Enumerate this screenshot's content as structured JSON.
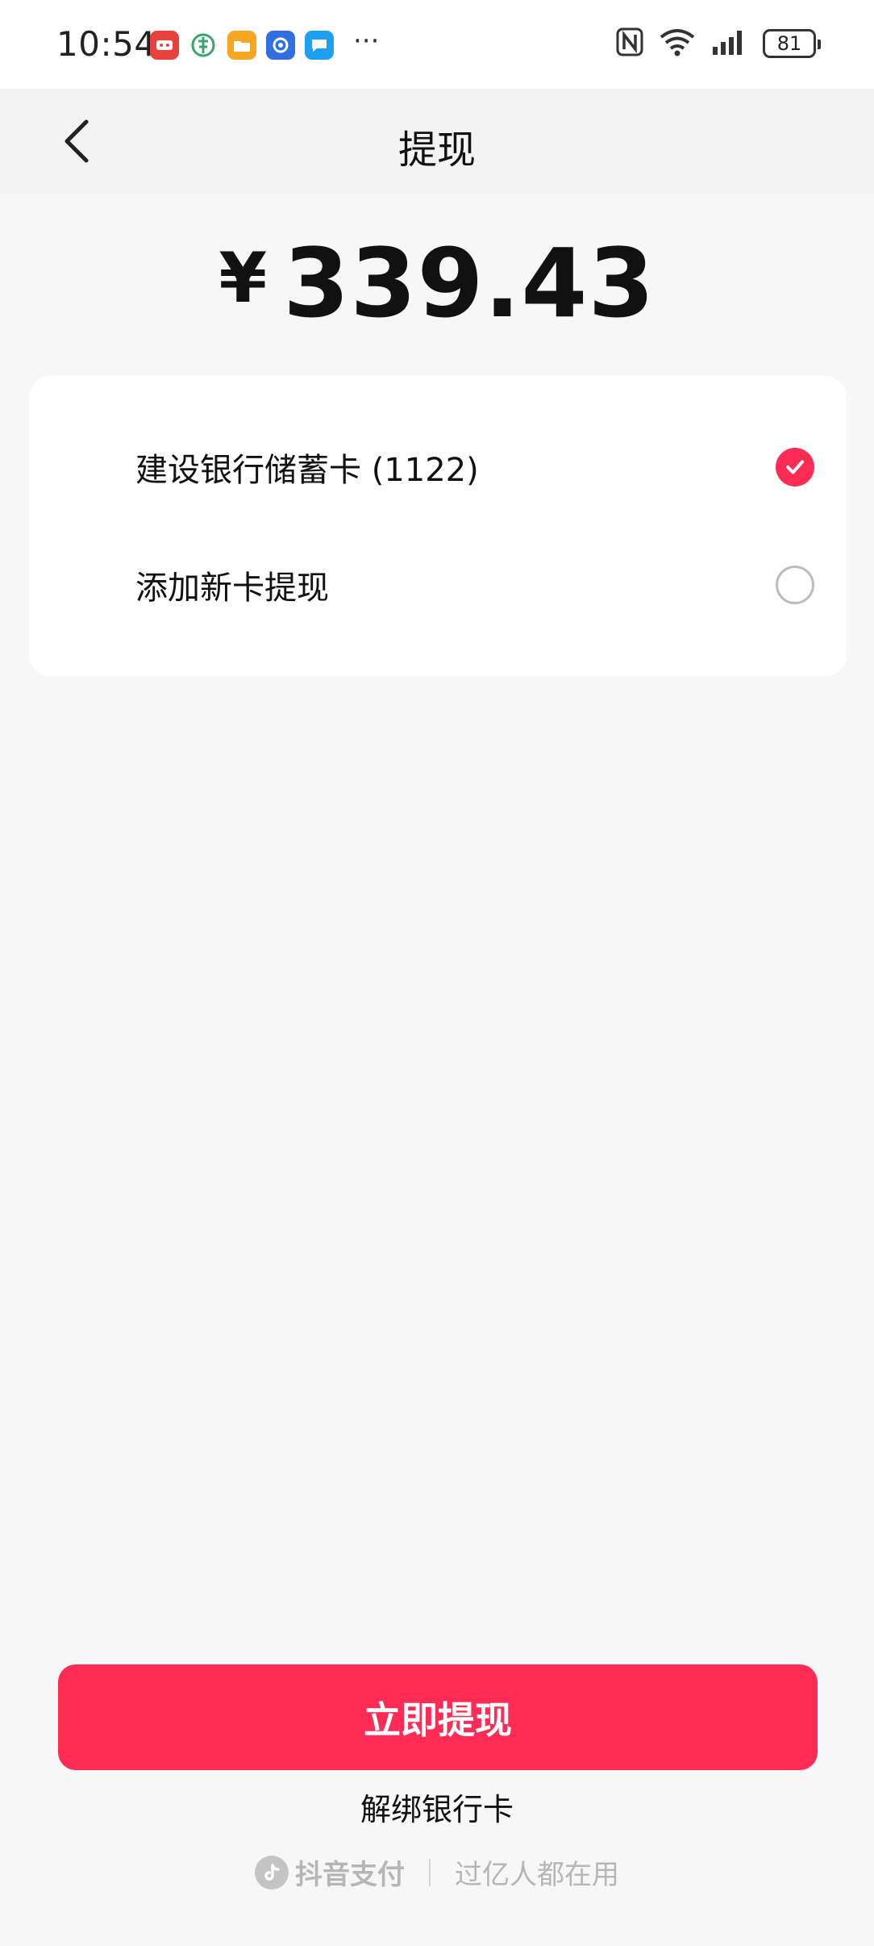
{
  "status_bar": {
    "time": "10:54",
    "battery": "81",
    "notification_icons": [
      {
        "name": "shopping-app-icon",
        "color": "#e8403a"
      },
      {
        "name": "health-app-icon",
        "color": "#3aa66d"
      },
      {
        "name": "files-app-icon",
        "color": "#f6a623"
      },
      {
        "name": "security-app-icon",
        "color": "#2f6fe0"
      },
      {
        "name": "message-app-icon",
        "color": "#1e9ff2"
      }
    ],
    "more": "···"
  },
  "header": {
    "title": "提现"
  },
  "amount": {
    "currency": "¥",
    "value": "339.43"
  },
  "cards": {
    "items": [
      {
        "label": "建设银行储蓄卡 (1122)",
        "selected": true
      },
      {
        "label": "添加新卡提现",
        "selected": false
      }
    ]
  },
  "actions": {
    "withdraw_label": "立即提现",
    "unbind_label": "解绑银行卡"
  },
  "footer": {
    "brand": "抖音支付",
    "slogan": "过亿人都在用"
  },
  "colors": {
    "accent": "#fe2c55",
    "background": "#f7f7f7",
    "card": "#ffffff"
  }
}
